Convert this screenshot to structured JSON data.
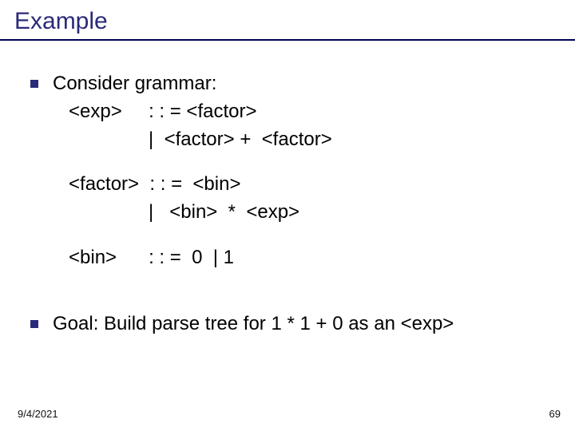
{
  "title": "Example",
  "bullet1": {
    "line1": "Consider grammar:",
    "g1": "   <exp>     : : = <factor>",
    "g2": "                  |  <factor> +  <factor>",
    "g3": "   <factor>  : : =  <bin>",
    "g4": "                  |   <bin>  *  <exp>",
    "g5": "   <bin>      : : =  0  | 1"
  },
  "bullet2": "Goal: Build parse tree for 1 * 1 + 0 as an <exp>",
  "footer": {
    "date": "9/4/2021",
    "page": "69"
  }
}
